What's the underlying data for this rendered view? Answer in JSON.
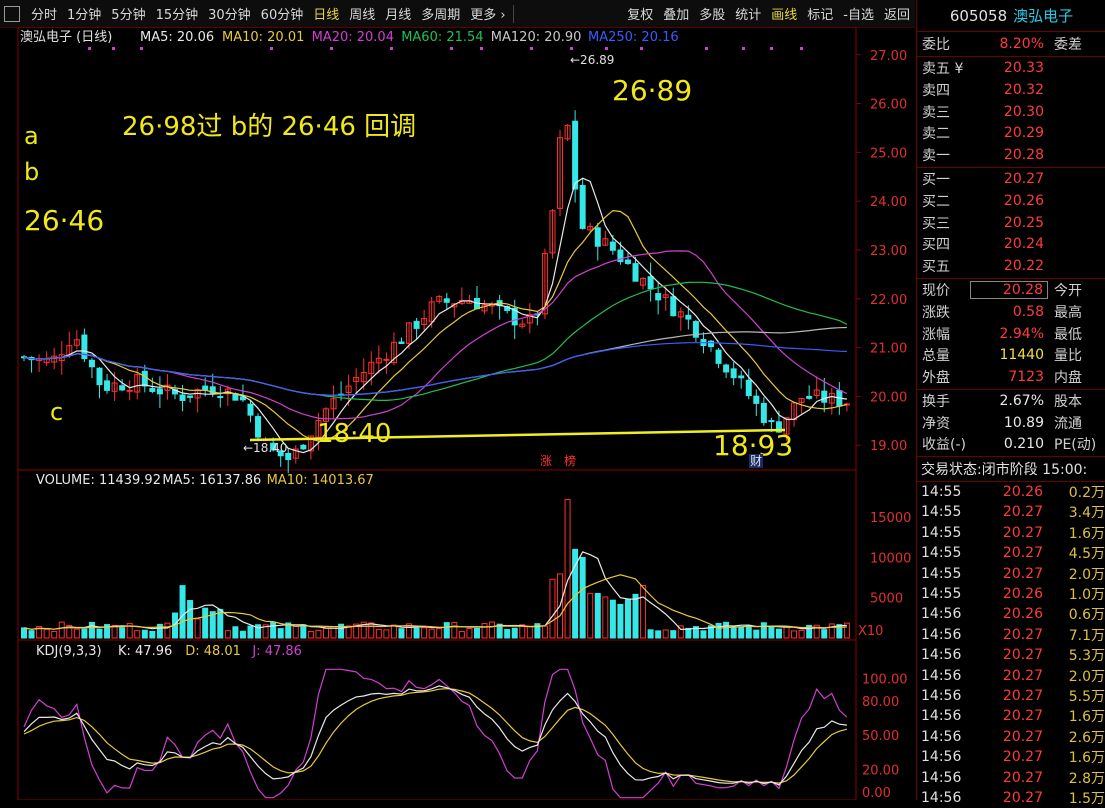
{
  "toolbar": {
    "periods": [
      "分时",
      "1分钟",
      "5分钟",
      "15分钟",
      "30分钟",
      "60分钟",
      "日线",
      "周线",
      "月线",
      "多周期",
      "更多 ›"
    ],
    "active_period": "日线",
    "tools": [
      "复权",
      "叠加",
      "多股",
      "统计",
      "画线",
      "标记",
      "-自选",
      "返回"
    ],
    "active_tool": "画线"
  },
  "main_chart": {
    "stock_label": "澳弘电子 (日线)",
    "ma_legend": [
      {
        "name": "MA5: 20.06",
        "color": "#e8e8e8"
      },
      {
        "name": "MA10: 20.01",
        "color": "#e8c93a"
      },
      {
        "name": "MA20: 20.04",
        "color": "#d040d0"
      },
      {
        "name": "MA60: 21.54",
        "color": "#20c050"
      },
      {
        "name": "MA120: 20.90",
        "color": "#c8c8c8"
      },
      {
        "name": "MA250: 20.16",
        "color": "#3a5cff"
      }
    ],
    "annotations": {
      "note": "26·98过 b的 26·46 回调",
      "a": "a",
      "b": "b",
      "c": "c",
      "level_2646": "26·46",
      "level_2689": "26·89",
      "level_1840": "18·40",
      "level_1893": "18·93",
      "high_marker": "26.89",
      "low_marker": "18.40",
      "zhang_tag": "涨",
      "bang_tag": "榜",
      "cai_tag": "财"
    },
    "y_ticks": [
      "27.00",
      "26.00",
      "25.00",
      "24.00",
      "23.00",
      "22.00",
      "21.00",
      "20.00",
      "19.00"
    ]
  },
  "volume_chart": {
    "legend": [
      {
        "name": "VOLUME: 11439.92",
        "color": "#e8e8e8"
      },
      {
        "name": "MA5: 16137.86",
        "color": "#e8e8e8"
      },
      {
        "name": "MA10: 14013.67",
        "color": "#e8c93a"
      }
    ],
    "y_ticks": [
      "15000",
      "10000",
      "5000"
    ],
    "unit": "X10"
  },
  "kdj_chart": {
    "legend": [
      {
        "name": "KDJ(9,3,3)",
        "color": "#e8e8e8"
      },
      {
        "name": "K: 47.96",
        "color": "#e8e8e8"
      },
      {
        "name": "D: 48.01",
        "color": "#e8c93a"
      },
      {
        "name": "J: 47.86",
        "color": "#d040d0"
      }
    ],
    "y_ticks": [
      "100.00",
      "80.00",
      "50.00",
      "20.00",
      "0.00"
    ]
  },
  "chart_data": {
    "type": "candlestick",
    "price_range": [
      18.8,
      27.2
    ],
    "last_close": 20.28,
    "high": 26.89,
    "low": 18.4
  },
  "quote": {
    "code": "605058",
    "name": "澳弘电子",
    "weibi_label": "委比",
    "weibi_value": "8.20%",
    "weicha_label": "委差",
    "asks": [
      {
        "label": "卖五 ¥",
        "price": "20.33"
      },
      {
        "label": "卖四",
        "price": "20.32"
      },
      {
        "label": "卖三",
        "price": "20.30"
      },
      {
        "label": "卖二",
        "price": "20.29"
      },
      {
        "label": "卖一",
        "price": "20.28"
      }
    ],
    "bids": [
      {
        "label": "买一",
        "price": "20.27"
      },
      {
        "label": "买二",
        "price": "20.26"
      },
      {
        "label": "买三",
        "price": "20.25"
      },
      {
        "label": "买四",
        "price": "20.24"
      },
      {
        "label": "买五",
        "price": "20.22"
      }
    ],
    "stats": [
      {
        "l": "现价",
        "v": "20.28",
        "c": "red",
        "r": "今开"
      },
      {
        "l": "涨跌",
        "v": "0.58",
        "c": "red",
        "r": "最高"
      },
      {
        "l": "涨幅",
        "v": "2.94%",
        "c": "red",
        "r": "最低"
      },
      {
        "l": "总量",
        "v": "11440",
        "c": "yellow",
        "r": "量比"
      },
      {
        "l": "外盘",
        "v": "7123",
        "c": "red",
        "r": "内盘"
      }
    ],
    "stats2": [
      {
        "l": "换手",
        "v": "2.67%",
        "r": "股本"
      },
      {
        "l": "净资",
        "v": "10.89",
        "r": "流通"
      },
      {
        "l": "收益(-)",
        "v": "0.210",
        "r": "PE(动)"
      }
    ],
    "status_label": "交易状态:",
    "status_value": "闭市阶段 15:00:",
    "ticks": [
      {
        "t": "14:55",
        "p": "20.26",
        "v": "0.2万"
      },
      {
        "t": "14:55",
        "p": "20.27",
        "v": "3.4万"
      },
      {
        "t": "14:55",
        "p": "20.27",
        "v": "1.6万"
      },
      {
        "t": "14:55",
        "p": "20.27",
        "v": "4.5万"
      },
      {
        "t": "14:55",
        "p": "20.27",
        "v": "2.0万"
      },
      {
        "t": "14:55",
        "p": "20.26",
        "v": "1.0万"
      },
      {
        "t": "14:56",
        "p": "20.26",
        "v": "0.6万"
      },
      {
        "t": "14:56",
        "p": "20.27",
        "v": "7.1万"
      },
      {
        "t": "14:56",
        "p": "20.27",
        "v": "5.3万"
      },
      {
        "t": "14:56",
        "p": "20.27",
        "v": "2.0万"
      },
      {
        "t": "14:56",
        "p": "20.27",
        "v": "5.5万"
      },
      {
        "t": "14:56",
        "p": "20.27",
        "v": "1.6万"
      },
      {
        "t": "14:56",
        "p": "20.27",
        "v": "2.6万"
      },
      {
        "t": "14:56",
        "p": "20.27",
        "v": "1.6万"
      },
      {
        "t": "14:56",
        "p": "20.27",
        "v": "2.8万"
      },
      {
        "t": "14:56",
        "p": "20.27",
        "v": "1.5万"
      }
    ]
  }
}
